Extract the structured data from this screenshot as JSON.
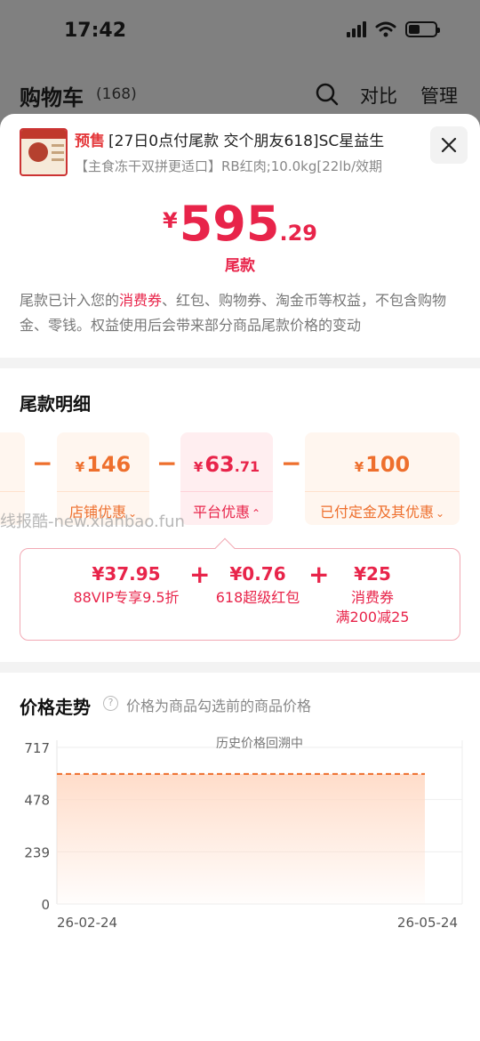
{
  "status_bar": {
    "time": "17:42"
  },
  "background": {
    "title": "购物车",
    "count": "(168)",
    "compare_label": "对比",
    "manage_label": "管理"
  },
  "product": {
    "presale_tag": "预售",
    "title": "[27日0点付尾款 交个朋友618]SC星益生",
    "sku": "【主食冻干双拼更适口】RB红肉;10.0kg[22lb/效期"
  },
  "final_payment": {
    "currency": "¥",
    "integer": "595",
    "decimal": ".29",
    "label": "尾款",
    "note_prefix": "尾款已计入您的",
    "note_highlight": "消费券",
    "note_suffix": "、红包、购物券、淘金币等权益，不包含购物金、零钱。权益使用后会带来部分商品尾款价格的变动"
  },
  "breakdown": {
    "title": "尾款明细",
    "minus_sign": "−",
    "cards": [
      {
        "currency": "¥",
        "integer": "146",
        "decimal": "",
        "label": "店铺优惠",
        "chevron": "⌄",
        "active": false
      },
      {
        "currency": "¥",
        "integer": "63",
        "decimal": ".71",
        "label": "平台优惠",
        "chevron": "⌃",
        "active": true
      },
      {
        "currency": "¥",
        "integer": "100",
        "decimal": "",
        "label": "已付定金及其优惠",
        "chevron": "⌄",
        "active": false
      }
    ],
    "platform_details": [
      {
        "value": "¥37.95",
        "label": "88VIP专享9.5折",
        "label2": ""
      },
      {
        "value": "¥0.76",
        "label": "618超级红包",
        "label2": ""
      },
      {
        "value": "¥25",
        "label": "消费券",
        "label2": "满200减25"
      }
    ],
    "plus_sign": "+"
  },
  "watermark": "线报酷-new.xianbao.fun",
  "price_trend": {
    "title": "价格走势",
    "help_icon": "?",
    "note": "价格为商品勾选前的商品价格"
  },
  "chart_data": {
    "type": "area",
    "annotation": "历史价格回溯中",
    "x": [
      "26-02-24",
      "26-05-24"
    ],
    "y_ticks": [
      0,
      239,
      478,
      717
    ],
    "ylim": [
      0,
      717
    ],
    "series": [
      {
        "values": [
          595.29,
          595.29
        ]
      }
    ],
    "grid": true,
    "colors": {
      "line": "#ee6f2d",
      "fill": "#ffd9c4"
    }
  },
  "colors": {
    "accent_red": "#e8244a",
    "accent_orange": "#ee6f2d"
  }
}
